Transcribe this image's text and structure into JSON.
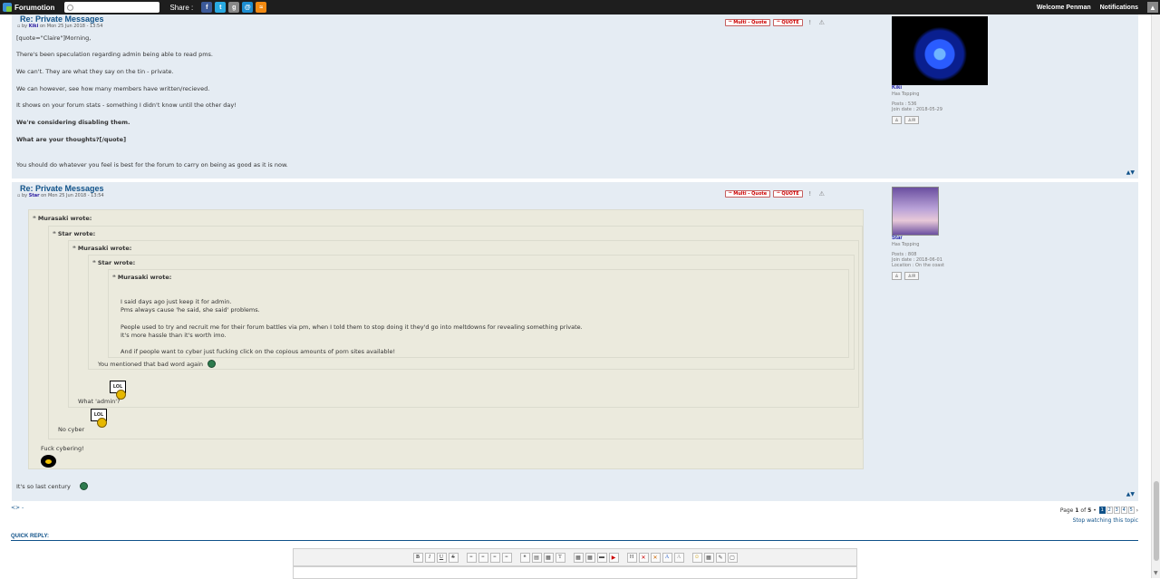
{
  "topbar": {
    "brand": "Forumotion",
    "search_placeholder": "",
    "share_label": "Share :",
    "share_icons": [
      "facebook-icon",
      "twitter-icon",
      "google-plus-icon",
      "email-icon",
      "rss-icon"
    ],
    "welcome": "Welcome Penman",
    "notifications": "Notifications"
  },
  "post1": {
    "title": "Re: Private Messages",
    "by_prefix": "by",
    "author": "Kiki",
    "date": "on Mon 25 Jun 2018 - 13:54",
    "multi_quote": "Multi - Quote",
    "quote": "QUOTE",
    "lines": [
      "[quote=\"Claire\"]Morning,",
      "There's been speculation regarding admin being able to read pms.",
      "We can't. They are what they say on the tin - private.",
      "We can however, see how many members have written/recieved.",
      "It shows on your forum stats - something I didn't know until the other day!",
      "We're considering disabling them.",
      "What are your thoughts?[/quote]",
      "You should do whatever you feel is best for the forum to carry on being as good as it is now."
    ],
    "profile": {
      "name": "Kiki",
      "rank": "Has Topping",
      "posts": "Posts : 536",
      "join": "Join date : 2018-05-29"
    }
  },
  "post2": {
    "title": "Re: Private Messages",
    "by_prefix": "by",
    "author": "Star",
    "date": "on Mon 25 Jun 2018 - 13:54",
    "multi_quote": "Multi - Quote",
    "quote": "QUOTE",
    "quotes": {
      "q1_head": "Murasaki wrote:",
      "q2_head": "Star wrote:",
      "q3_head": "Murasaki wrote:",
      "q4_head": "Star wrote:",
      "q5_head": "Murasaki wrote:",
      "q5_lines": [
        "I said days ago just keep it for admin.",
        "Pms always cause 'he said, she said' problems.",
        "People used to try and recruit me for their forum battles via pm, when I told them to stop doing it they'd go into meltdowns for revealing something private.",
        "It's more hassle than it's worth imo.",
        "And if people want to cyber just fucking click on the copious amounts of porn sites available!"
      ],
      "q4_text": "You mentioned that bad word again",
      "q3_text": "What 'admin'?",
      "q2_text": "No cyber",
      "q1_text": "Fuck cybering!",
      "lol_label": "LOL"
    },
    "reply": "It's so last century",
    "profile": {
      "name": "Star",
      "rank": "Has Topping",
      "posts": "Posts : 808",
      "join": "Join date : 2018-06-01",
      "location": "Location : On the coast"
    }
  },
  "nav": {
    "bottom_left": "<> -",
    "page_text_prefix": "Page",
    "page_current": "1",
    "page_of": "of",
    "page_total": "5",
    "pages": [
      "1",
      "2",
      "3",
      "4",
      "5"
    ],
    "next_arrow": "›",
    "stop_watching": "Stop watching this topic",
    "quick_reply": "QUICK REPLY:"
  },
  "editor": {
    "buttons": [
      "B",
      "I",
      "U",
      "S",
      "≡",
      "≡",
      "≡",
      "≡",
      "❝",
      "▤",
      "▦",
      "T",
      "▦",
      "▦",
      "▬",
      "▶",
      "H",
      "✕",
      "✕",
      "A",
      "A",
      "☺",
      "▦",
      "✎",
      "▢"
    ]
  }
}
